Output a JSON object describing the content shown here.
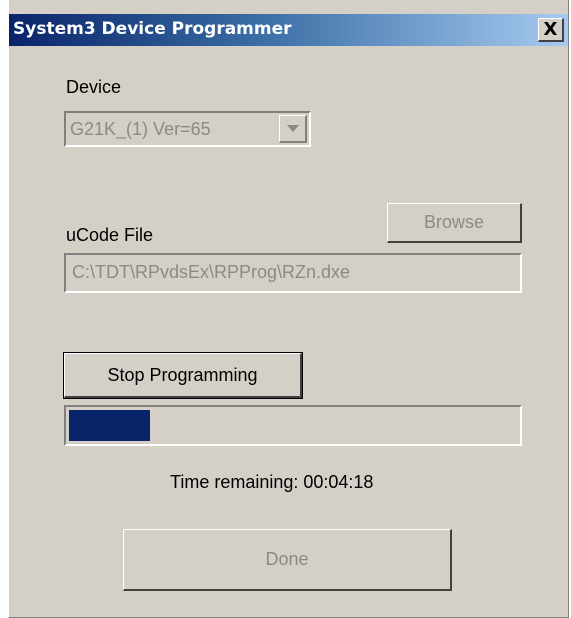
{
  "window": {
    "title": "System3 Device Programmer",
    "close_glyph": "X"
  },
  "device": {
    "label": "Device",
    "selected": "G21K_(1)   Ver=65"
  },
  "ucode": {
    "label": "uCode File",
    "browse_label": "Browse",
    "path": "C:\\TDT\\RPvdsEx\\RPProg\\RZn.dxe"
  },
  "programming": {
    "stop_label": "Stop Programming",
    "progress_fraction": 0.18,
    "progress_color": "#0a246a",
    "time_remaining": "Time remaining: 00:04:18"
  },
  "footer": {
    "done_label": "Done"
  },
  "icons": {
    "close": "close-icon",
    "dropdown": "chevron-down-icon"
  }
}
